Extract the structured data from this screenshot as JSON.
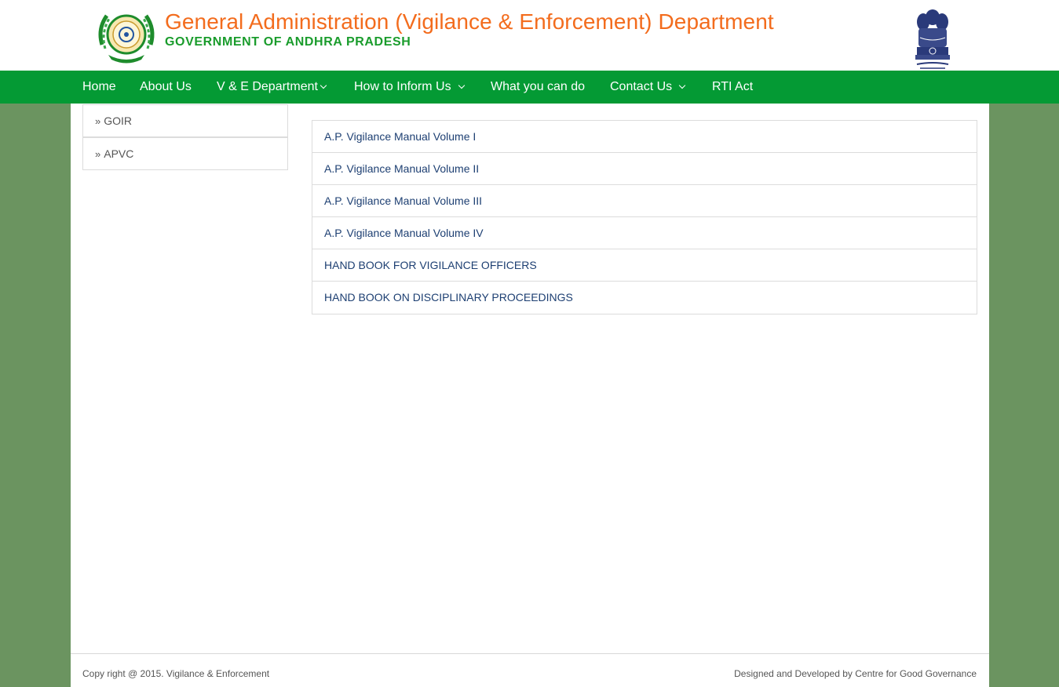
{
  "header": {
    "title": "General Administration (Vigilance & Enforcement) Department",
    "subtitle": "GOVERNMENT OF ANDHRA PRADESH"
  },
  "nav": {
    "items": [
      {
        "label": "Home",
        "dropdown": false
      },
      {
        "label": "About Us",
        "dropdown": false
      },
      {
        "label": "V & E Department",
        "dropdown": true
      },
      {
        "label": "How to Inform Us",
        "dropdown": true
      },
      {
        "label": "What you can do",
        "dropdown": false
      },
      {
        "label": "Contact Us",
        "dropdown": true
      },
      {
        "label": "RTI Act",
        "dropdown": false
      }
    ]
  },
  "sidebar": {
    "items": [
      {
        "label": "GOIR"
      },
      {
        "label": "APVC"
      }
    ]
  },
  "documents": {
    "items": [
      {
        "label": "A.P. Vigilance Manual Volume I"
      },
      {
        "label": "A.P. Vigilance Manual Volume II"
      },
      {
        "label": "A.P. Vigilance Manual Volume III"
      },
      {
        "label": "A.P. Vigilance Manual Volume IV"
      },
      {
        "label": "HAND BOOK FOR VIGILANCE OFFICERS"
      },
      {
        "label": "HAND BOOK ON DISCIPLINARY PROCEEDINGS"
      }
    ]
  },
  "footer": {
    "copyright": "Copy right @ 2015. Vigilance & Enforcement",
    "credit": "Designed and Developed by Centre for Good Governance"
  },
  "colors": {
    "title_orange": "#f36c1d",
    "subtitle_green": "#1a9c2c",
    "nav_green": "#049a34",
    "page_bg": "#6b9460",
    "link_blue": "#1d3f72"
  }
}
